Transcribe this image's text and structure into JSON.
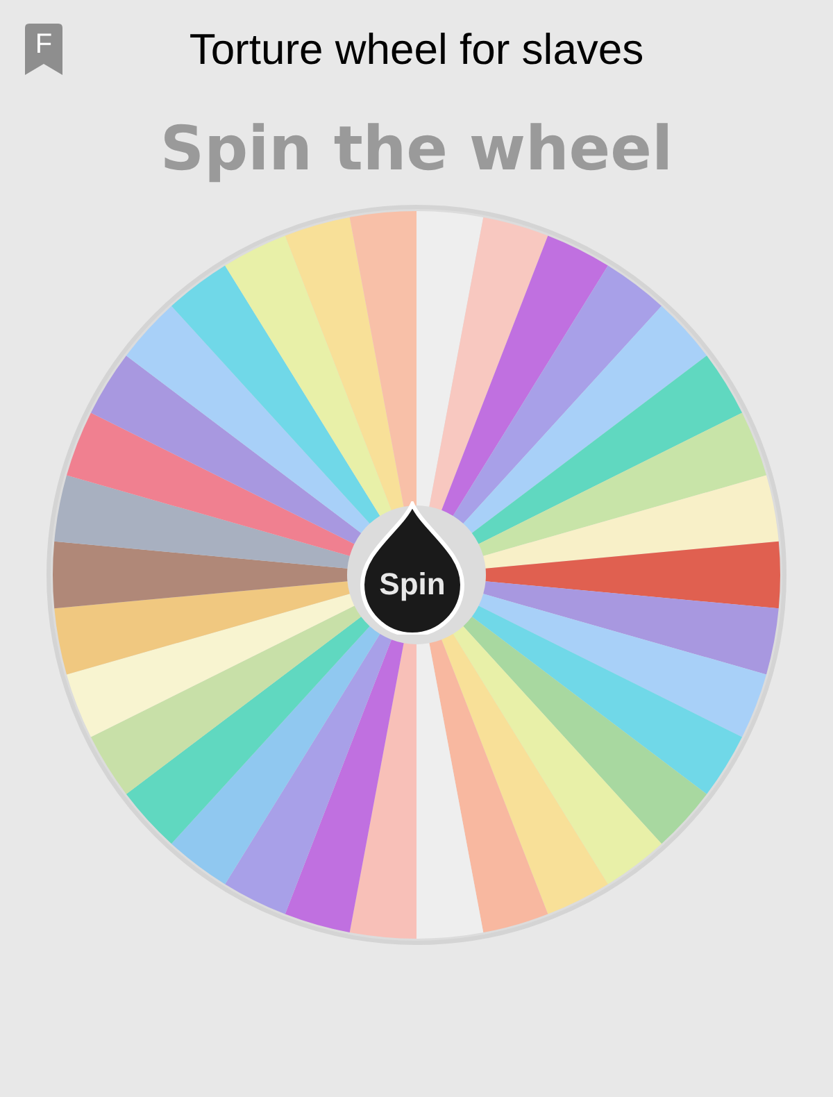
{
  "header": {
    "badge_letter": "F",
    "title": "Torture wheel for slaves"
  },
  "heading": "Spin the wheel",
  "wheel": {
    "spin_label": "Spin",
    "segments": [
      {
        "color": "#eeeeee"
      },
      {
        "color": "#f8c8c0"
      },
      {
        "color": "#c070e0"
      },
      {
        "color": "#a8a0e8"
      },
      {
        "color": "#a8d0f8"
      },
      {
        "color": "#60d8c0"
      },
      {
        "color": "#c8e4a8"
      },
      {
        "color": "#f8f0c8"
      },
      {
        "color": "#e06050"
      },
      {
        "color": "#a898e0"
      },
      {
        "color": "#a8d0f8"
      },
      {
        "color": "#70d8e8"
      },
      {
        "color": "#a8d8a0"
      },
      {
        "color": "#e8f0a8"
      },
      {
        "color": "#f8e098"
      },
      {
        "color": "#f8b8a0"
      },
      {
        "color": "#eeeeee"
      },
      {
        "color": "#f8c0b8"
      },
      {
        "color": "#c070e0"
      },
      {
        "color": "#a8a0e8"
      },
      {
        "color": "#90c8f0"
      },
      {
        "color": "#60d8c0"
      },
      {
        "color": "#c8e0a8"
      },
      {
        "color": "#f8f4d0"
      },
      {
        "color": "#f0c880"
      },
      {
        "color": "#b08878"
      },
      {
        "color": "#a8b0c0"
      },
      {
        "color": "#f08090"
      },
      {
        "color": "#a898e0"
      },
      {
        "color": "#a8d0f8"
      },
      {
        "color": "#70d8e8"
      },
      {
        "color": "#e8f0a8"
      },
      {
        "color": "#f8e098"
      },
      {
        "color": "#f8c0a8"
      }
    ]
  }
}
